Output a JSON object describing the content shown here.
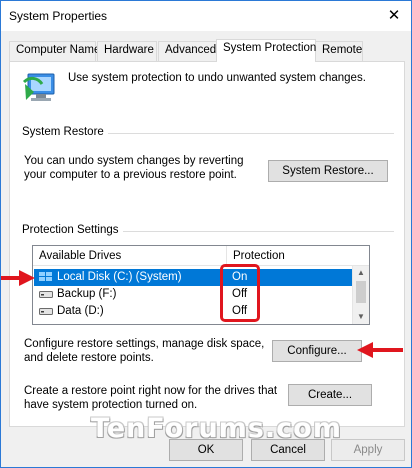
{
  "window": {
    "title": "System Properties",
    "close_glyph": "✕"
  },
  "tabs": [
    {
      "label": "Computer Name",
      "active": false
    },
    {
      "label": "Hardware",
      "active": false
    },
    {
      "label": "Advanced",
      "active": false
    },
    {
      "label": "System Protection",
      "active": true
    },
    {
      "label": "Remote",
      "active": false
    }
  ],
  "intro": {
    "icon": "system-protection-computer-icon",
    "text": "Use system protection to undo unwanted system changes."
  },
  "system_restore": {
    "group_label": "System Restore",
    "description_line1": "You can undo system changes by reverting",
    "description_line2": "your computer to a previous restore point.",
    "button_label": "System Restore..."
  },
  "protection_settings": {
    "group_label": "Protection Settings",
    "columns": [
      "Available Drives",
      "Protection"
    ],
    "drives": [
      {
        "name": "Local Disk (C:) (System)",
        "protection": "On",
        "icon": "windows-drive-icon",
        "selected": true
      },
      {
        "name": "Backup (F:)",
        "protection": "Off",
        "icon": "drive-icon",
        "selected": false
      },
      {
        "name": "Data (D:)",
        "protection": "Off",
        "icon": "drive-icon",
        "selected": false
      }
    ],
    "configure_text_line1": "Configure restore settings, manage disk space,",
    "configure_text_line2": "and delete restore points.",
    "configure_button": "Configure...",
    "create_text_line1": "Create a restore point right now for the drives that",
    "create_text_line2": "have system protection turned on.",
    "create_button": "Create..."
  },
  "watermark": "TenForums.com",
  "buttons": {
    "ok": "OK",
    "cancel": "Cancel",
    "apply": "Apply"
  },
  "colors": {
    "selection": "#0078d7",
    "annotation_red": "#e0161e",
    "accent_border": "#2b79d6"
  }
}
